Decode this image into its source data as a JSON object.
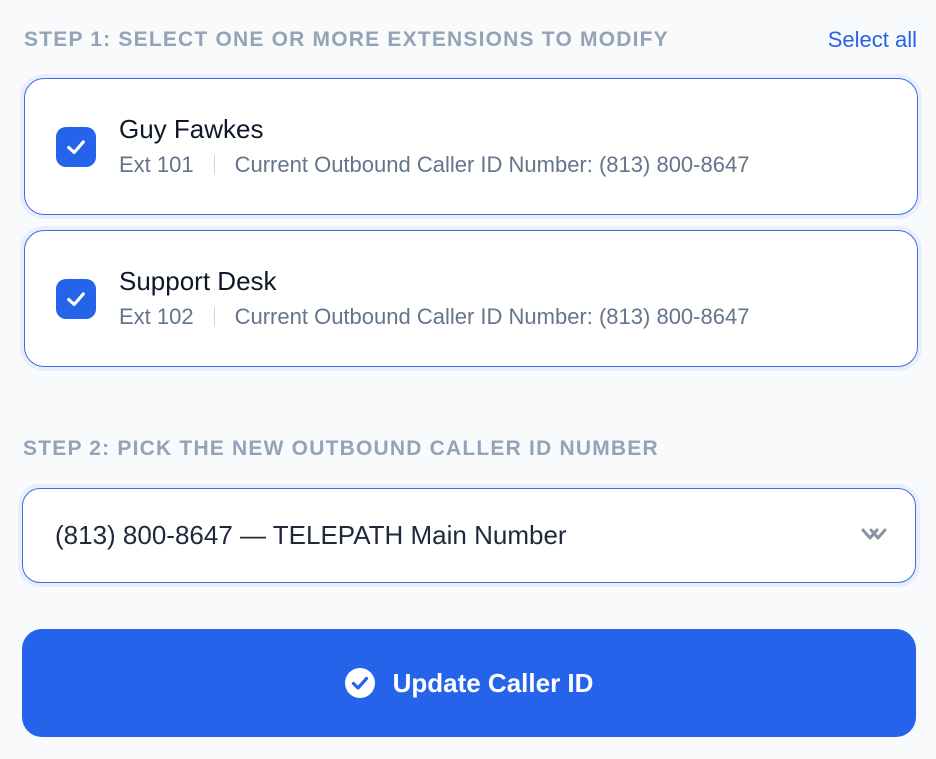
{
  "step1": {
    "title": "STEP 1: SELECT ONE OR MORE EXTENSIONS TO MODIFY",
    "select_all": "Select all"
  },
  "extensions": [
    {
      "name": "Guy Fawkes",
      "ext": "Ext 101",
      "caller_id": "Current Outbound Caller ID Number: (813) 800-8647",
      "checked": true
    },
    {
      "name": "Support Desk",
      "ext": "Ext 102",
      "caller_id": "Current Outbound Caller ID Number: (813) 800-8647",
      "checked": true
    }
  ],
  "step2": {
    "title": "STEP 2: PICK THE NEW OUTBOUND CALLER ID NUMBER",
    "selected_value": "(813) 800-8647 — TELEPATH Main Number"
  },
  "update_button": {
    "label": "Update Caller ID",
    "icon": "check-circle-icon"
  },
  "colors": {
    "accent": "#2563eb",
    "muted": "#94a3b8",
    "background": "#f8fafc"
  }
}
